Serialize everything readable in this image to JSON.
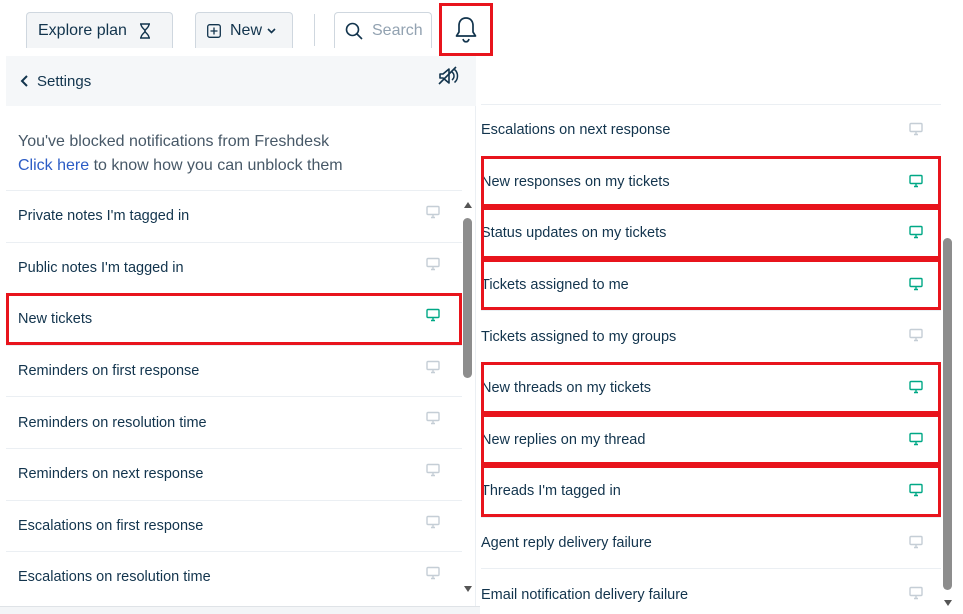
{
  "topbar": {
    "explore_label": "Explore plan",
    "new_label": "New",
    "search_placeholder": "Search"
  },
  "settings": {
    "back_label": "Settings",
    "blocked_text": "You've blocked notifications from Freshdesk",
    "link_text": "Click here",
    "link_rest": " to know how you can unblock them"
  },
  "left_items": [
    {
      "label": "Private notes I'm tagged in",
      "enabled": false
    },
    {
      "label": "Public notes I'm tagged in",
      "enabled": false
    },
    {
      "label": "New tickets",
      "enabled": true
    },
    {
      "label": "Reminders on first response",
      "enabled": false
    },
    {
      "label": "Reminders on resolution time",
      "enabled": false
    },
    {
      "label": "Reminders on next response",
      "enabled": false
    },
    {
      "label": "Escalations on first response",
      "enabled": false
    },
    {
      "label": "Escalations on resolution time",
      "enabled": false
    }
  ],
  "right_items": [
    {
      "label": "Escalations on next response",
      "enabled": false
    },
    {
      "label": "New responses on my tickets",
      "enabled": true
    },
    {
      "label": "Status updates on my tickets",
      "enabled": true
    },
    {
      "label": "Tickets assigned to me",
      "enabled": true
    },
    {
      "label": "Tickets assigned to my groups",
      "enabled": false
    },
    {
      "label": "New threads on my tickets",
      "enabled": true
    },
    {
      "label": "New replies on my thread",
      "enabled": true
    },
    {
      "label": "Threads I'm tagged in",
      "enabled": true
    },
    {
      "label": "Agent reply delivery failure",
      "enabled": false
    },
    {
      "label": "Email notification delivery failure",
      "enabled": false
    }
  ],
  "colors": {
    "enabled_icon": "#00a886",
    "disabled_icon": "#c5ced6",
    "highlight": "#e8141c",
    "link": "#2c5cc5"
  }
}
